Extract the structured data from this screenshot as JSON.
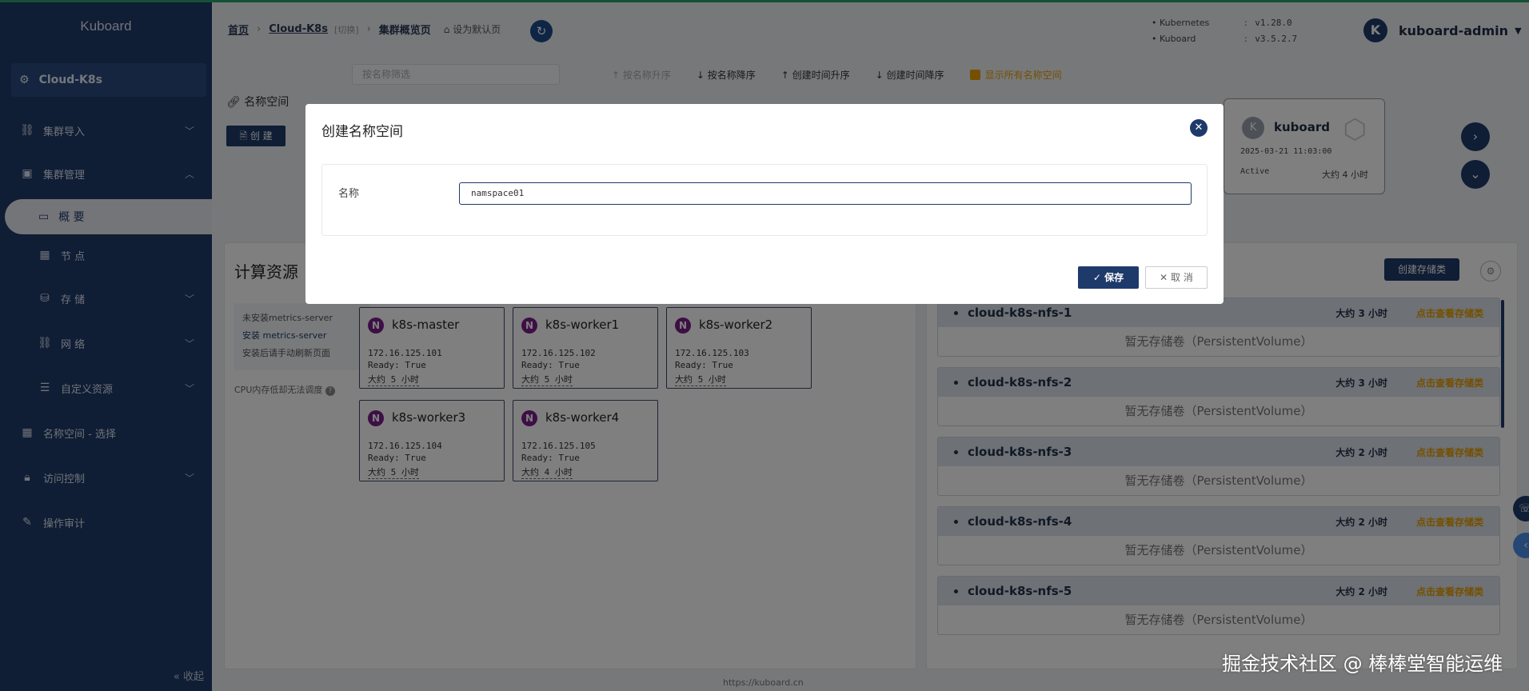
{
  "sidebar": {
    "logo": "Kuboard",
    "cluster": "Cloud-K8s",
    "items": [
      {
        "label": "集群导入"
      },
      {
        "label": "集群管理"
      },
      {
        "label": "概 要"
      },
      {
        "label": "节 点"
      },
      {
        "label": "存 储"
      },
      {
        "label": "网 络"
      },
      {
        "label": "自定义资源"
      },
      {
        "label": "名称空间 - 选择"
      },
      {
        "label": "访问控制"
      },
      {
        "label": "操作审计"
      }
    ],
    "collapse": "收起"
  },
  "breadcrumb": {
    "home": "首页",
    "cluster": "Cloud-K8s",
    "switch": "[切换]",
    "page": "集群概览页",
    "set_default": "设为默认页"
  },
  "versions": [
    {
      "name": "Kubernetes",
      "value": "v1.28.0"
    },
    {
      "name": "Kuboard",
      "value": "v3.5.2.7"
    }
  ],
  "user": {
    "avatar": "K",
    "name": "kuboard-admin"
  },
  "namespace_bar": {
    "filter_placeholder": "按名称筛选",
    "sort_name_asc": "按名称升序",
    "sort_name_desc": "按名称降序",
    "sort_time_asc": "创建时间升序",
    "sort_time_desc": "创建时间降序",
    "show_all": "显示所有名称空间",
    "label": "名称空间",
    "create": "创 建"
  },
  "ns_card": {
    "avatar": "K",
    "name": "kuboard",
    "created": "2025-03-21 11:03:00",
    "status": "Active",
    "age": "大约 4 小时"
  },
  "compute": {
    "title": "计算资源",
    "metrics_missing": "未安装metrics-server",
    "install_metrics": "安装 metrics-server",
    "refresh_hint": "安装后请手动刷新页面",
    "cpu_note": "CPU内存低却无法调度",
    "nodes": [
      {
        "badge": "N",
        "name": "k8s-master",
        "ip": "172.16.125.101",
        "ready": "Ready: True",
        "age": "大约 5 小时"
      },
      {
        "badge": "N",
        "name": "k8s-worker1",
        "ip": "172.16.125.102",
        "ready": "Ready: True",
        "age": "大约 5 小时"
      },
      {
        "badge": "N",
        "name": "k8s-worker2",
        "ip": "172.16.125.103",
        "ready": "Ready: True",
        "age": "大约 5 小时"
      },
      {
        "badge": "N",
        "name": "k8s-worker3",
        "ip": "172.16.125.104",
        "ready": "Ready: True",
        "age": "大约 5 小时"
      },
      {
        "badge": "N",
        "name": "k8s-worker4",
        "ip": "172.16.125.105",
        "ready": "Ready: True",
        "age": "大约 4 小时"
      }
    ]
  },
  "storage": {
    "create_button": "创建存储类",
    "classes": [
      {
        "name": "cloud-k8s-nfs-1",
        "age": "大约 3 小时",
        "link": "点击查看存储类",
        "empty": "暂无存储卷（PersistentVolume）"
      },
      {
        "name": "cloud-k8s-nfs-2",
        "age": "大约 3 小时",
        "link": "点击查看存储类",
        "empty": "暂无存储卷（PersistentVolume）"
      },
      {
        "name": "cloud-k8s-nfs-3",
        "age": "大约 2 小时",
        "link": "点击查看存储类",
        "empty": "暂无存储卷（PersistentVolume）"
      },
      {
        "name": "cloud-k8s-nfs-4",
        "age": "大约 2 小时",
        "link": "点击查看存储类",
        "empty": "暂无存储卷（PersistentVolume）"
      },
      {
        "name": "cloud-k8s-nfs-5",
        "age": "大约 2 小时",
        "link": "点击查看存储类",
        "empty": "暂无存储卷（PersistentVolume）"
      }
    ]
  },
  "footer": {
    "url": "https://kuboard.cn"
  },
  "watermark": "掘金技术社区 @ 棒棒堂智能运维",
  "dialog": {
    "title": "创建名称空间",
    "field_label": "名称",
    "field_value": "namspace01",
    "save": "保存",
    "cancel": "取 消"
  },
  "colors": {
    "primary": "#1e3a6a",
    "accent": "#e8a000",
    "node_badge": "#7a1f8a"
  }
}
